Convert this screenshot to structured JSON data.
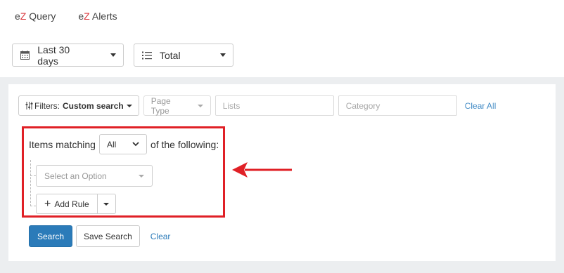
{
  "nav": {
    "items": [
      {
        "brand_prefix": "e",
        "brand_z": "Z",
        "label": " Query"
      },
      {
        "brand_prefix": "e",
        "brand_z": "Z",
        "label": " Alerts"
      }
    ]
  },
  "controls": {
    "date_range": {
      "label": "Last 30 days",
      "icon": "calendar-icon"
    },
    "aggregation": {
      "label": "Total",
      "icon": "list-icon"
    }
  },
  "filters": {
    "filters_prefix": "Filters:",
    "filters_value": "Custom search",
    "page_type": "Page Type",
    "lists_placeholder": "Lists",
    "category_placeholder": "Category",
    "clear_all": "Clear All"
  },
  "rules": {
    "items_matching": "Items matching",
    "match_value": "All",
    "of_following": "of the following:",
    "select_option": "Select an Option",
    "add_rule": "Add Rule"
  },
  "actions": {
    "search": "Search",
    "save_search": "Save Search",
    "clear": "Clear"
  },
  "colors": {
    "brand_accent": "#d9373c",
    "primary_button": "#2b7bb9",
    "highlight": "#e02026",
    "link": "#4a90c8"
  }
}
